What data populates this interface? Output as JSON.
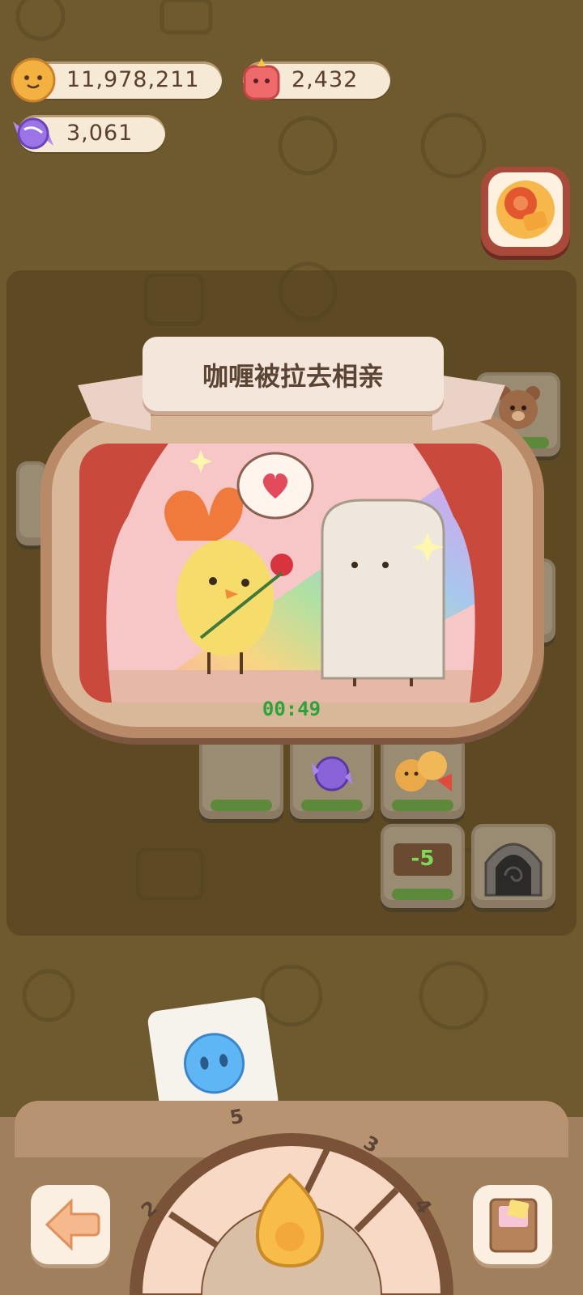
{
  "resources": {
    "coins": "11,978,211",
    "gems": "2,432",
    "candies": "3,061"
  },
  "event_popup": {
    "title": "咖喱被拉去相亲",
    "timer": "00:49"
  },
  "board": {
    "sign_value": "-5"
  },
  "wheel": {
    "segments": [
      "2",
      "5",
      "3",
      "4"
    ]
  },
  "colors": {
    "background": "#6e5a2e",
    "pill": "#f6ead6",
    "timer": "#2aa43a",
    "frame": "#b98a68"
  },
  "icons": [
    "cookie-coin-icon",
    "gummy-gem-icon",
    "candy-icon",
    "boost-icon",
    "back-arrow-icon",
    "album-icon",
    "egg-icon",
    "teddy-bear-icon",
    "ghost-icon"
  ]
}
